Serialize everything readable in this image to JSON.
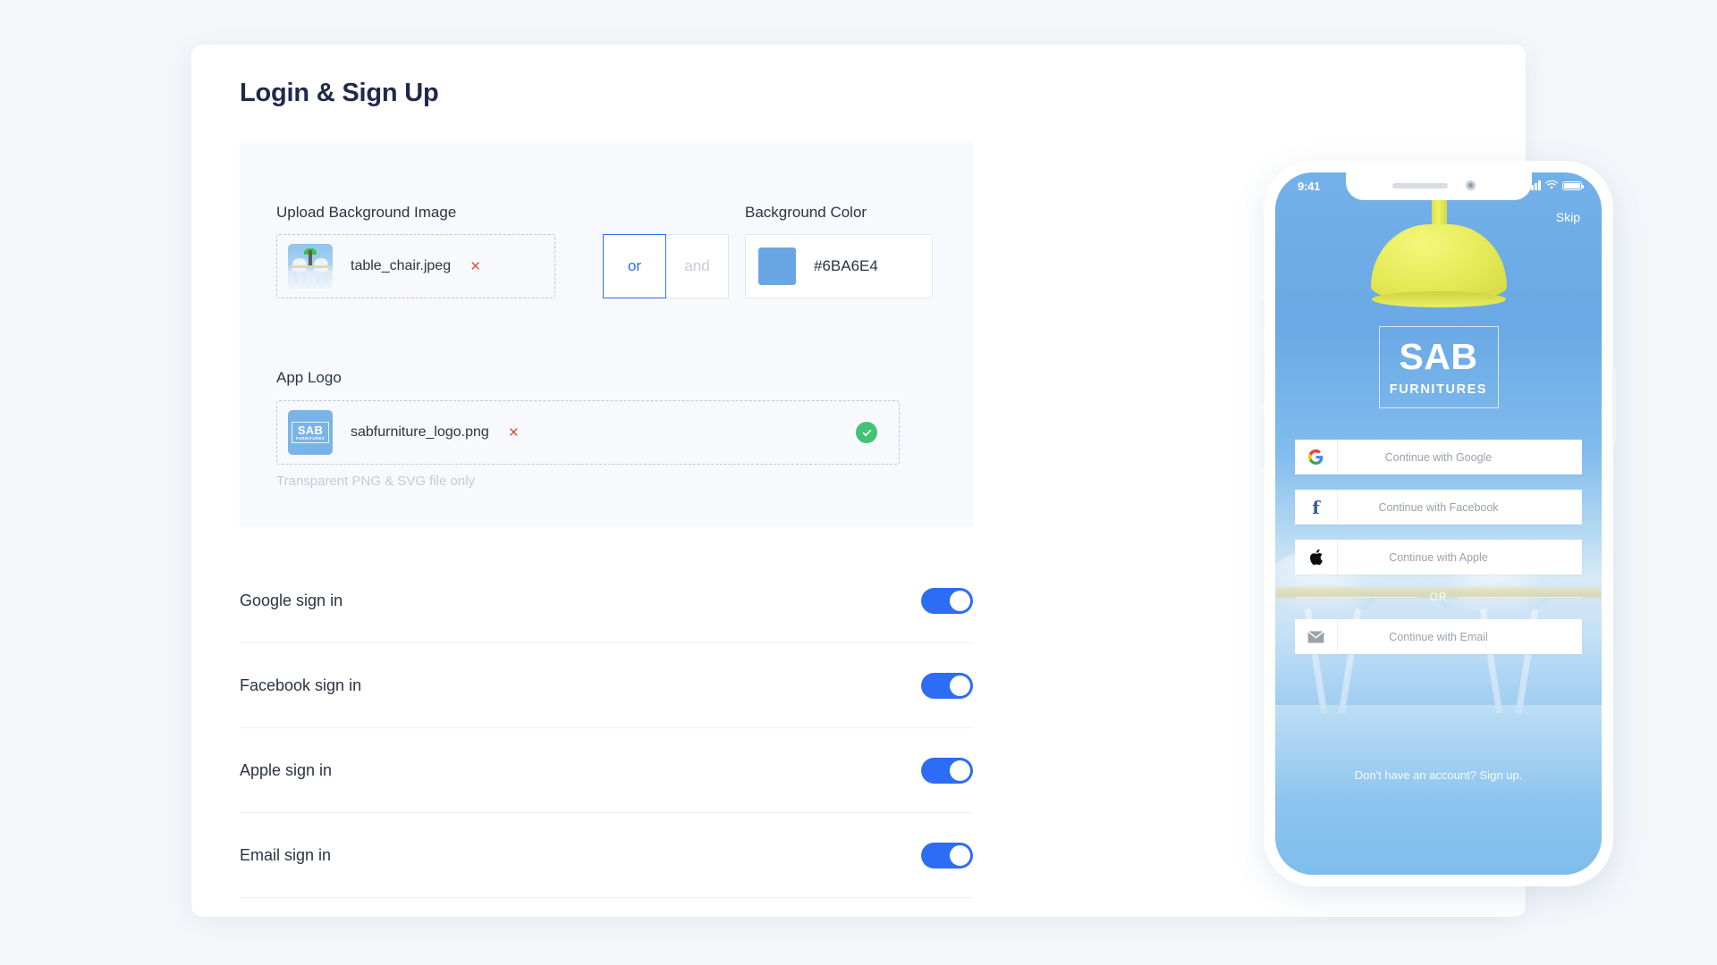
{
  "page": {
    "title": "Login & Sign Up",
    "background_color": "#F4F6FA",
    "card_background": "#FFFFFF"
  },
  "upload_panel": {
    "background_color": "#F8F9FC",
    "background_image": {
      "label": "Upload Background Image",
      "file_name": "table_chair.jpeg",
      "remove_icon": "×",
      "thumbnail_name": "table-chair-photo-thumbnail"
    },
    "conjunction": {
      "options": [
        "or",
        "and"
      ],
      "selected": "or",
      "selected_color": "#2D6DF6",
      "unselected_color": "#C7CCD6"
    },
    "background_color_field": {
      "label": "Background Color",
      "value": "#6BA6E4",
      "swatch_color": "#6BA6E4"
    },
    "app_logo": {
      "label": "App Logo",
      "file_name": "sabfurniture_logo.png",
      "remove_icon": "×",
      "status_icon": "check-circle",
      "status_color": "#42C275",
      "helper_text": "Transparent PNG & SVG file only",
      "thumbnail": {
        "brand": "SAB",
        "sub": "FURNITURES",
        "background": "#79B4E8"
      }
    }
  },
  "sign_in_toggles": {
    "accent_color": "#2D6DF6",
    "items": [
      {
        "label": "Google sign in",
        "enabled": true
      },
      {
        "label": "Facebook sign in",
        "enabled": true
      },
      {
        "label": "Apple sign in",
        "enabled": true
      },
      {
        "label": "Email sign in",
        "enabled": true
      }
    ]
  },
  "phone_preview": {
    "status_bar": {
      "time": "9:41",
      "signal_icon": "cellular-signal-icon",
      "wifi_icon": "wifi-icon",
      "battery_icon": "battery-icon"
    },
    "skip_label": "Skip",
    "brand": {
      "name": "SAB",
      "tagline": "FURNITURES"
    },
    "auth_buttons": [
      {
        "label": "Continue with Google",
        "icon": "google-icon"
      },
      {
        "label": "Continue with Facebook",
        "icon": "facebook-icon"
      },
      {
        "label": "Continue with Apple",
        "icon": "apple-icon"
      },
      {
        "label": "Continue with Email",
        "icon": "email-icon"
      }
    ],
    "divider_text": "OR",
    "signup_text": "Don't have an account? Sign up."
  }
}
